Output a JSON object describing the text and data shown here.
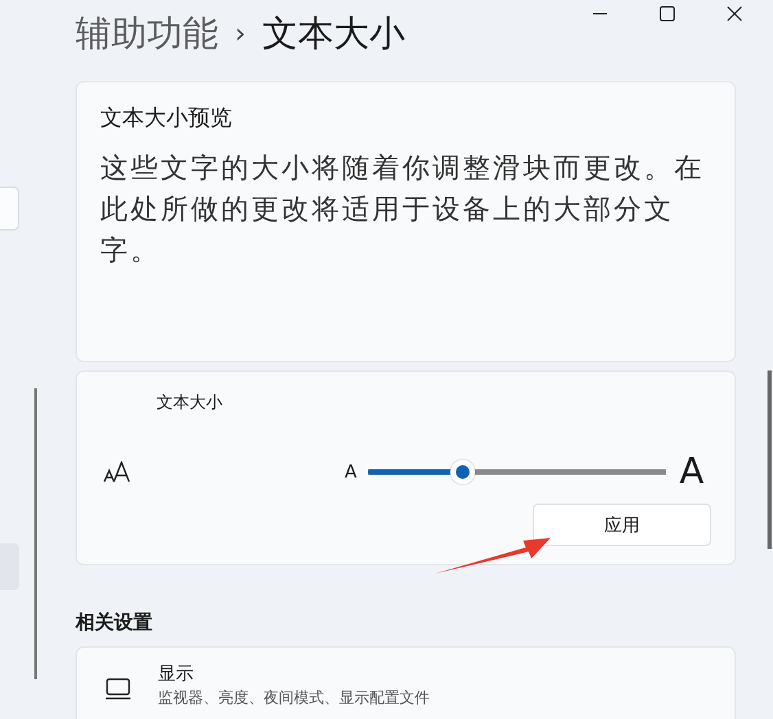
{
  "breadcrumb": {
    "parent": "辅助功能",
    "separator": "›",
    "current": "文本大小"
  },
  "preview": {
    "title": "文本大小预览",
    "body": "这些文字的大小将随着你调整滑块而更改。在此处所做的更改将适用于设备上的大部分文字。"
  },
  "text_size": {
    "label": "文本大小",
    "small_a": "A",
    "large_a": "A",
    "level": 0.32,
    "apply_button": "应用"
  },
  "related": {
    "heading": "相关设置",
    "items": [
      {
        "title": "显示",
        "subtitle": "监视器、亮度、夜间模式、显示配置文件"
      }
    ]
  }
}
